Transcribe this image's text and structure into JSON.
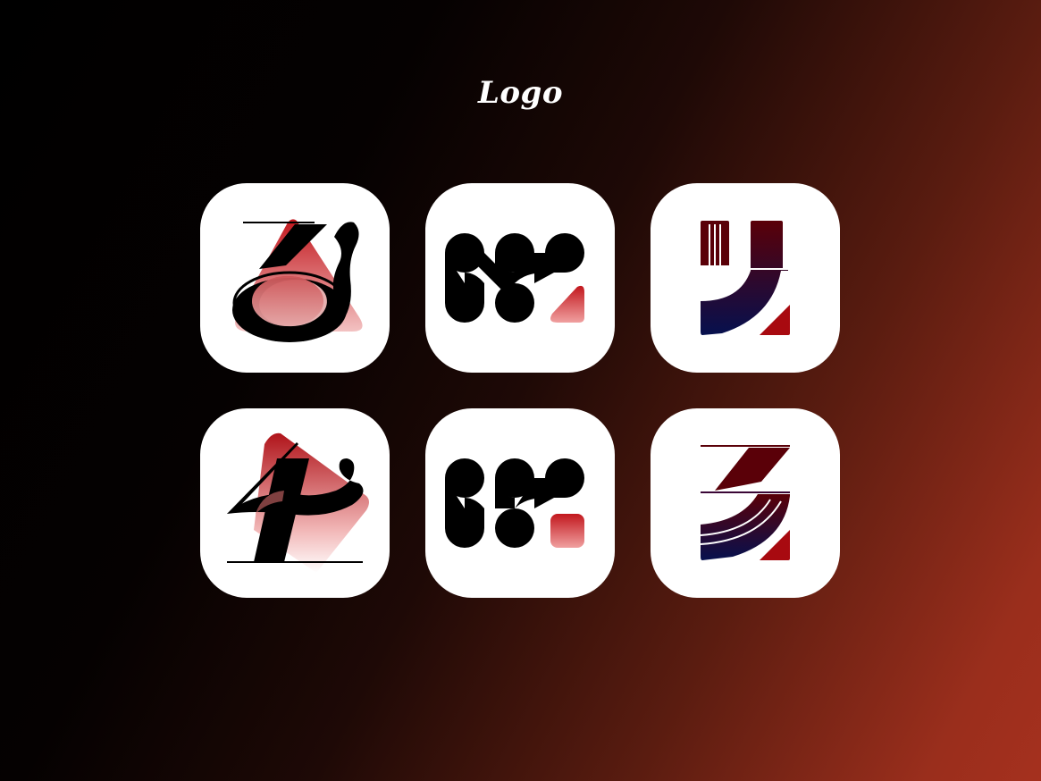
{
  "header": {
    "title": "Logo"
  },
  "colors": {
    "background_start": "#000000",
    "background_end": "#a5301e",
    "tile": "#ffffff",
    "mark": "#000000",
    "accent_red": "#a80a10",
    "accent_pink": "#f09a9a",
    "accent_navy": "#0a0f5c"
  },
  "logos": [
    {
      "id": "logo-1",
      "icon": "serif-z-on-red-triangle-icon"
    },
    {
      "id": "logo-2",
      "icon": "blob-wave-with-pink-triangle-icon"
    },
    {
      "id": "logo-3",
      "icon": "gradient-y-with-red-triangle-icon"
    },
    {
      "id": "logo-4",
      "icon": "serif-4-on-red-diamond-icon"
    },
    {
      "id": "logo-5",
      "icon": "blob-wave-with-pink-square-icon"
    },
    {
      "id": "logo-6",
      "icon": "gradient-3-with-red-triangle-icon"
    }
  ]
}
